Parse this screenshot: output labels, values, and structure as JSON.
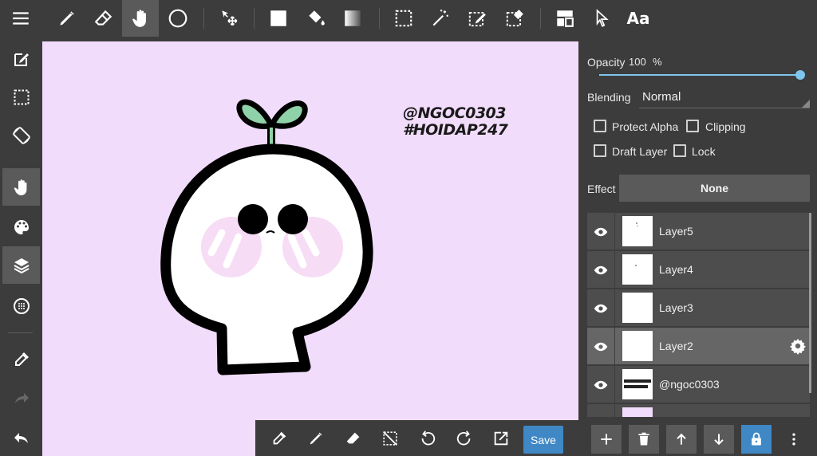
{
  "toolbar": {
    "aa_label": "Aa"
  },
  "canvas": {
    "background": "#f2dcfb",
    "watermark_line1": "@NGOC0303",
    "watermark_line2": "#HOIDAP247"
  },
  "bottom_toolbar": {
    "save_label": "Save",
    "accent": "#3f88c5"
  },
  "layer_properties": {
    "opacity_label": "Opacity",
    "opacity_value": "100",
    "opacity_unit": "%",
    "opacity_fraction": 1.0,
    "blending_label": "Blending",
    "blending_value": "Normal",
    "protect_alpha_label": "Protect Alpha",
    "clipping_label": "Clipping",
    "draft_layer_label": "Draft Layer",
    "lock_label": "Lock",
    "effect_label": "Effect",
    "effect_value": "None"
  },
  "layers": [
    {
      "name": "Layer5",
      "selected": false
    },
    {
      "name": "Layer4",
      "selected": false
    },
    {
      "name": "Layer3",
      "selected": false
    },
    {
      "name": "Layer2",
      "selected": true
    },
    {
      "name": "@ngoc0303",
      "selected": false
    }
  ],
  "colors": {
    "panel_bg": "#3c3c3c",
    "selected_row": "#666666",
    "slider": "#7fc6ee",
    "lock_button": "#3f88c5"
  }
}
